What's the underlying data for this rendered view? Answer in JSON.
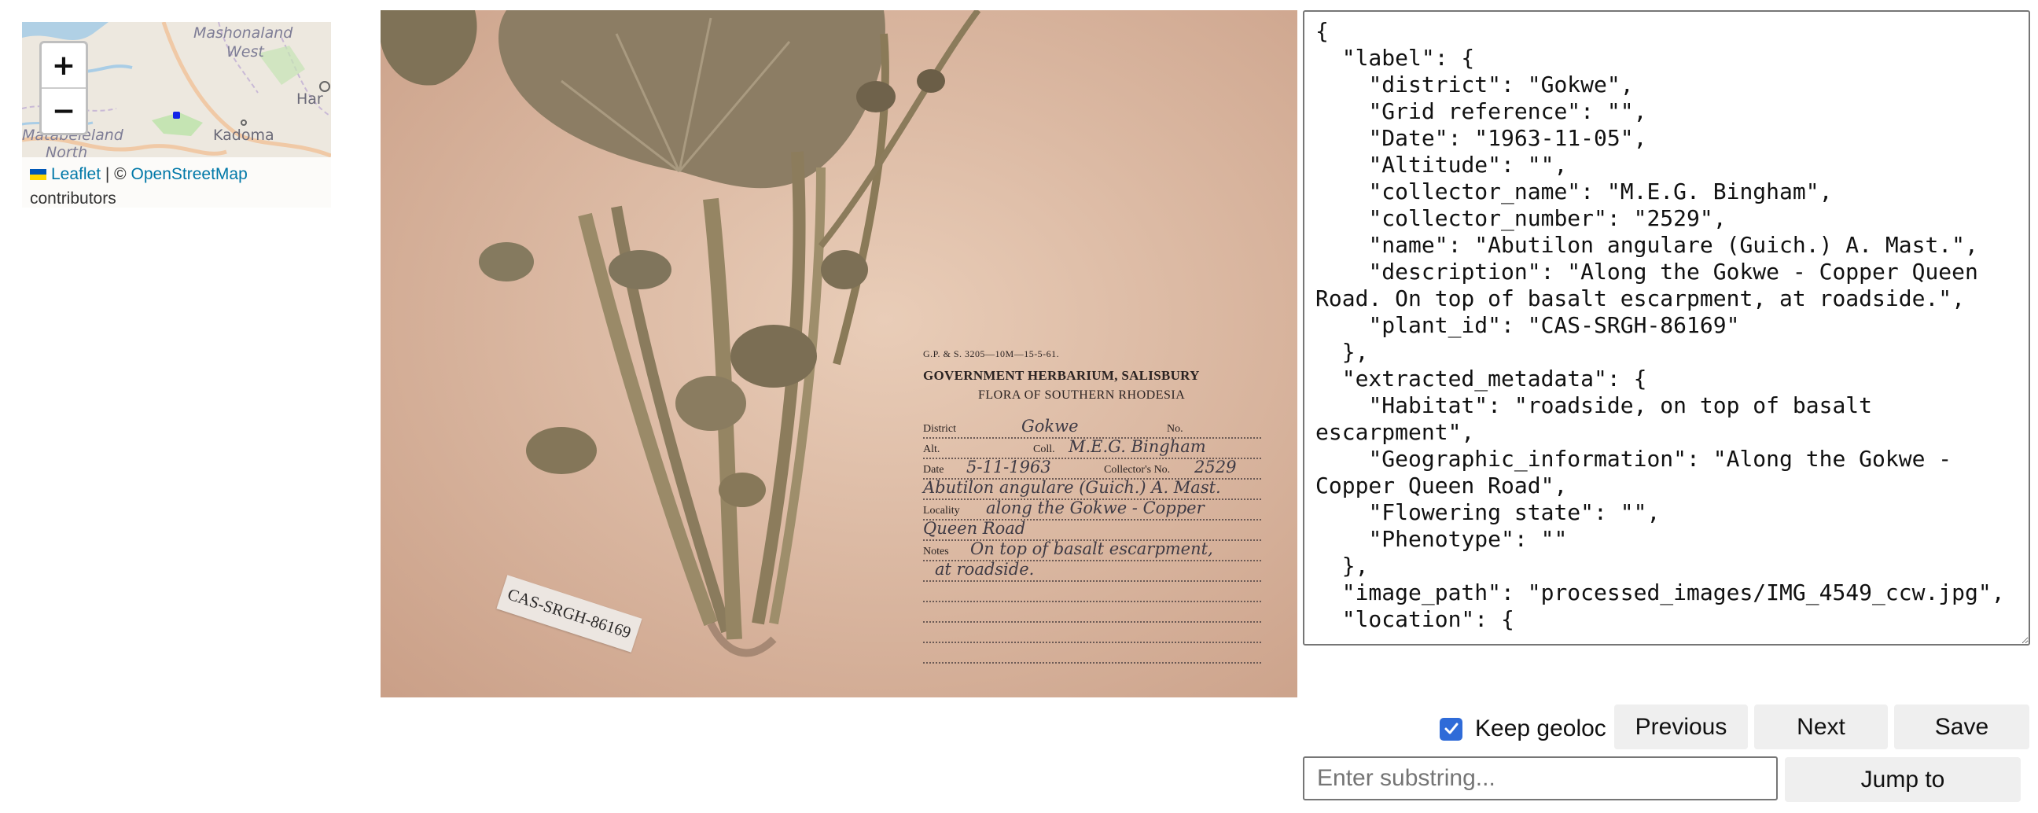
{
  "map": {
    "places": {
      "mashonaland": "Mashonaland",
      "west": "West",
      "harare": "Har",
      "kadoma": "Kadoma",
      "matabeleland": "Matabeleland",
      "north": "North"
    },
    "zoom_in": "+",
    "zoom_out": "−",
    "attribution": {
      "leaflet": "Leaflet",
      "separator": " | © ",
      "osm": "OpenStreetMap",
      "contributors": "contributors"
    },
    "colors": {
      "water": "#a9cde6",
      "roads": "#f0c9a6",
      "green": "#c5e4b3",
      "marker": "#1224e8"
    }
  },
  "specimen": {
    "label": {
      "printer_line": "G.P. & S. 3205—10M—15-5-61.",
      "institution": "GOVERNMENT HERBARIUM, SALISBURY",
      "flora": "FLORA OF SOUTHERN RHODESIA",
      "district_key": "District",
      "district_value": "Gokwe",
      "no_key": "No.",
      "alt_key": "Alt.",
      "coll_key": "Coll.",
      "coll_value": "M.E.G. Bingham",
      "date_key": "Date",
      "date_value": "5-11-1963",
      "collector_no_key": "Collector's No.",
      "collector_no_value": "2529",
      "name_value": "Abutilon angulare (Guich.) A. Mast.",
      "locality_key": "Locality",
      "locality_value": "along the Gokwe - Copper",
      "locality_value2": "Queen Road",
      "notes_key": "Notes",
      "notes_value": "On top of basalt escarpment,",
      "notes_value2": "at roadside."
    },
    "barcode": "CAS-SRGH-86169"
  },
  "json_editor": {
    "content": "{\n  \"label\": {\n    \"district\": \"Gokwe\",\n    \"Grid reference\": \"\",\n    \"Date\": \"1963-11-05\",\n    \"Altitude\": \"\",\n    \"collector_name\": \"M.E.G. Bingham\",\n    \"collector_number\": \"2529\",\n    \"name\": \"Abutilon angulare (Guich.) A. Mast.\",\n    \"description\": \"Along the Gokwe - Copper Queen Road. On top of basalt escarpment, at roadside.\",\n    \"plant_id\": \"CAS-SRGH-86169\"\n  },\n  \"extracted_metadata\": {\n    \"Habitat\": \"roadside, on top of basalt escarpment\",\n    \"Geographic_information\": \"Along the Gokwe - Copper Queen Road\",\n    \"Flowering state\": \"\",\n    \"Phenotype\": \"\"\n  },\n  \"image_path\": \"processed_images/IMG_4549_ccw.jpg\",\n  \"location\": {"
  },
  "controls": {
    "keep_geoloc_label": "Keep geoloc",
    "keep_geoloc_checked": true,
    "previous": "Previous",
    "next": "Next",
    "save": "Save",
    "search_placeholder": "Enter substring...",
    "jump_to": "Jump to"
  }
}
